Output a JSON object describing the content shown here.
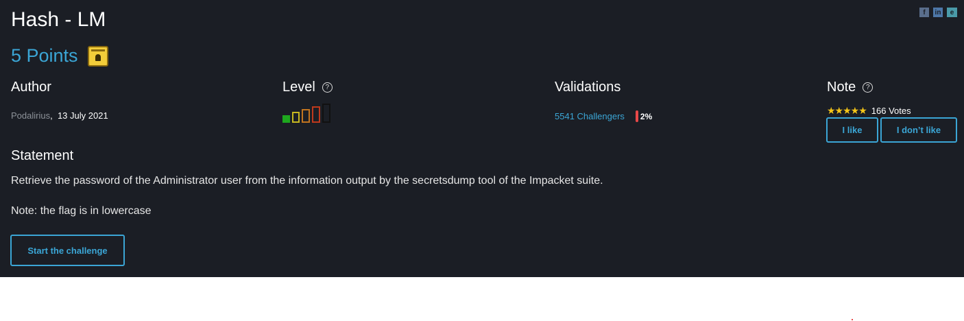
{
  "challenge": {
    "title": "Hash - LM",
    "points": "5 Points"
  },
  "author": {
    "heading": "Author",
    "name": "Podalirius",
    "separator": ",",
    "date": "13 July 2021"
  },
  "level": {
    "heading": "Level",
    "help": "?",
    "value": 1,
    "max": 5,
    "colors": [
      "#1ea81e",
      "#c8b820",
      "#c2741f",
      "#c0391c",
      "#111111"
    ]
  },
  "validations": {
    "heading": "Validations",
    "challengers": "5541 Challengers",
    "percent": "2%"
  },
  "note": {
    "heading": "Note",
    "help": "?",
    "stars": "★★★★★",
    "votes": "166 Votes",
    "like_label": "I like",
    "dislike_label": "I don’t like"
  },
  "statement": {
    "heading": "Statement",
    "text": "Retrieve the password of the Administrator user from the information output by the secretsdump tool of the Impacket suite.",
    "note": "Note: the flag is in lowercase"
  },
  "actions": {
    "start_label": "Start the challenge"
  },
  "share": {
    "facebook": "f",
    "linkedin": "in",
    "other": "e"
  },
  "colors": {
    "background": "#1b1e25",
    "accent": "#3ba6d6",
    "star": "#f5c518",
    "percent_bar": "#e84848"
  }
}
